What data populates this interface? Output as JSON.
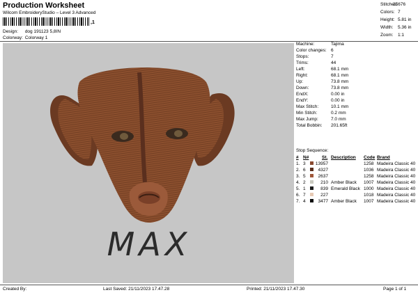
{
  "header": {
    "title": "Production Worksheet",
    "subtitle": "Wilcom EmbroideryStudio – Level 3 Advanced",
    "barcode_suffix": ",1",
    "design_label": "Design:",
    "design_value": "dog 191123 5,8IN",
    "colorway_label": "Colorway:",
    "colorway_value": "Colorway 1"
  },
  "summary": {
    "stitches_label": "Stitches:",
    "stitches": "25676",
    "colors_label": "Colors:",
    "colors": "7",
    "height_label": "Height:",
    "height": "5.81 in",
    "width_label": "Width:",
    "width": "5.36 in",
    "zoom_label": "Zoom:",
    "zoom": "1:1"
  },
  "design": {
    "text": "MAX"
  },
  "machine": {
    "machine_label": "Machine:",
    "machine": "Tajima",
    "color_changes_label": "Color changes:",
    "color_changes": "6",
    "stops_label": "Stops:",
    "stops": "7",
    "trims_label": "Trims:",
    "trims": "44",
    "left_label": "Left:",
    "left": "68.1 mm",
    "right_label": "Right:",
    "right": "68.1 mm",
    "up_label": "Up:",
    "up": "73.8 mm",
    "down_label": "Down:",
    "down": "73.8 mm",
    "endx_label": "EndX:",
    "endx": "0.00 in",
    "endy_label": "EndY:",
    "endy": "0.00 in",
    "max_stitch_label": "Max Stitch:",
    "max_stitch": "10.1 mm",
    "min_stitch_label": "Min Stitch:",
    "min_stitch": "0.2 mm",
    "max_jump_label": "Max Jump:",
    "max_jump": "7.0 mm",
    "total_bobbin_label": "Total Bobbin:",
    "total_bobbin": "201.65ft"
  },
  "stops": {
    "title": "Stop Sequence:",
    "headers": {
      "num": "#",
      "n": "N#",
      "st": "St.",
      "description": "Description",
      "code": "Code",
      "brand": "Brand"
    },
    "rows": [
      {
        "num": "1.",
        "n": "3",
        "color": "#8a4a30",
        "st": "13957",
        "desc": "",
        "code": "1258",
        "brand": "Madeira Classic 40"
      },
      {
        "num": "2.",
        "n": "6",
        "color": "#5a2f1e",
        "st": "4327",
        "desc": "",
        "code": "1036",
        "brand": "Madeira Classic 40"
      },
      {
        "num": "3.",
        "n": "5",
        "color": "#a0573a",
        "st": "2637",
        "desc": "",
        "code": "1258",
        "brand": "Madeira Classic 40"
      },
      {
        "num": "4.",
        "n": "2",
        "color": "#c9c9bf",
        "st": "210",
        "desc": "Amber Black",
        "code": "1007",
        "brand": "Madeira Classic 40"
      },
      {
        "num": "5.",
        "n": "1",
        "color": "#1c1c1c",
        "st": "839",
        "desc": "Emerald Black",
        "code": "1000",
        "brand": "Madeira Classic 40"
      },
      {
        "num": "6.",
        "n": "7",
        "color": "#e6c9b4",
        "st": "227",
        "desc": "",
        "code": "1018",
        "brand": "Madeira Classic 40"
      },
      {
        "num": "7.",
        "n": "4",
        "color": "#0d0d0d",
        "st": "3477",
        "desc": "Amber Black",
        "code": "1007",
        "brand": "Madeira Classic 40"
      }
    ]
  },
  "footer": {
    "created": "Created By:",
    "last_saved": "Last Saved: 21/11/2023 17.47.28",
    "printed": "Printed: 21/11/2023 17.47.30",
    "page": "Page 1 of 1"
  }
}
